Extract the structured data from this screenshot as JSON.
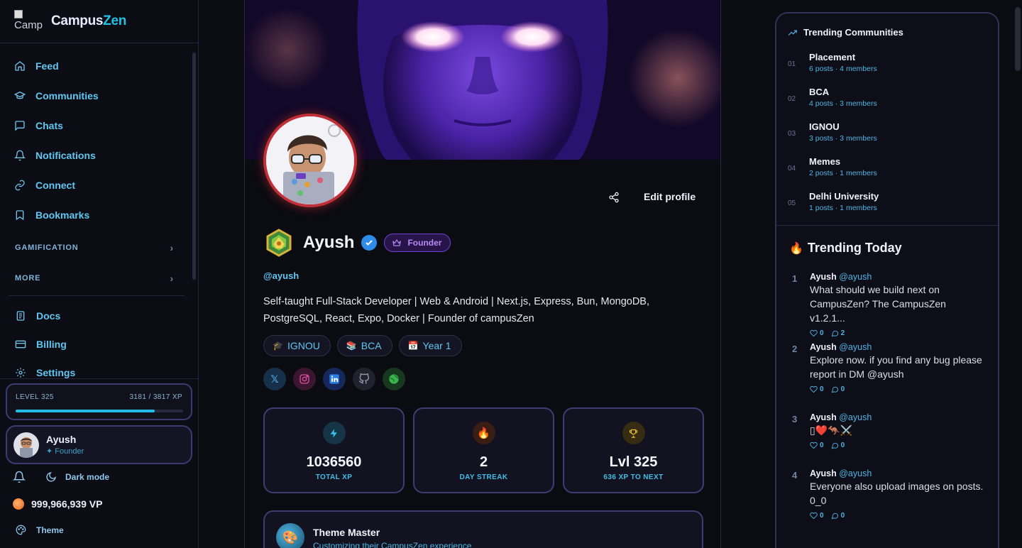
{
  "brand": {
    "logo_alt": "Camp",
    "name_part1": "Campus",
    "name_part2": "Zen"
  },
  "sidebar": {
    "nav": [
      {
        "label": "Feed",
        "icon": "home-icon"
      },
      {
        "label": "Communities",
        "icon": "graduation-cap-icon"
      },
      {
        "label": "Chats",
        "icon": "message-square-icon"
      },
      {
        "label": "Notifications",
        "icon": "bell-icon"
      },
      {
        "label": "Connect",
        "icon": "link-icon"
      },
      {
        "label": "Bookmarks",
        "icon": "bookmark-icon"
      }
    ],
    "section_gamification": "GAMIFICATION",
    "section_more": "MORE",
    "nav2": [
      {
        "label": "Docs",
        "icon": "document-icon"
      },
      {
        "label": "Billing",
        "icon": "credit-card-icon"
      },
      {
        "label": "Settings",
        "icon": "gear-icon"
      }
    ],
    "level": {
      "label": "LEVEL 325",
      "xp": "3181 / 3817 XP",
      "progress": 0.83
    },
    "user": {
      "name": "Ayush",
      "role": "✦ Founder"
    },
    "dark_mode_label": "Dark mode",
    "vp": "999,966,939 VP",
    "theme_label": "Theme"
  },
  "profile": {
    "edit_label": "Edit profile",
    "name": "Ayush",
    "founder_badge": "Founder",
    "handle": "@ayush",
    "bio": "Self-taught Full-Stack Developer | Web & Android | Next.js, Express, Bun, MongoDB, PostgreSQL, React, Expo, Docker | Founder of campusZen",
    "chips": [
      {
        "icon": "🎓",
        "label": "IGNOU"
      },
      {
        "icon": "📚",
        "label": "BCA"
      },
      {
        "icon": "📅",
        "label": "Year 1"
      }
    ],
    "stats": [
      {
        "value": "1036560",
        "label": "TOTAL XP"
      },
      {
        "value": "2",
        "label": "DAY STREAK"
      },
      {
        "value": "Lvl 325",
        "label": "636 XP TO NEXT"
      }
    ],
    "achievement": {
      "title": "Theme Master",
      "subtitle": "Customizing their CampusZen experience"
    }
  },
  "trending_communities": {
    "title": "Trending Communities",
    "items": [
      {
        "num": "01",
        "name": "Placement",
        "meta": "6 posts · 4 members"
      },
      {
        "num": "02",
        "name": "BCA",
        "meta": "4 posts · 3 members"
      },
      {
        "num": "03",
        "name": "IGNOU",
        "meta": "3 posts · 3 members"
      },
      {
        "num": "04",
        "name": "Memes",
        "meta": "2 posts · 1 members"
      },
      {
        "num": "05",
        "name": "Delhi University",
        "meta": "1 posts · 1 members"
      }
    ]
  },
  "trending_today": {
    "title": "Trending Today",
    "posts": [
      {
        "num": "1",
        "author": "Ayush",
        "handle": "@ayush",
        "text": "What should we build next on CampusZen? The CampusZen v1.2.1...",
        "likes": "0",
        "comments": "2"
      },
      {
        "num": "2",
        "author": "Ayush",
        "handle": "@ayush",
        "text": "Explore now. if you find any bug please report in DM @ayush",
        "likes": "0",
        "comments": "0"
      },
      {
        "num": "3",
        "author": "Ayush",
        "handle": "@ayush",
        "text": "▯❤️🦘⚔️",
        "likes": "0",
        "comments": "0"
      },
      {
        "num": "4",
        "author": "Ayush",
        "handle": "@ayush",
        "text": "Everyone also upload images on posts. 0_0",
        "likes": "0",
        "comments": "0"
      }
    ]
  },
  "colors": {
    "accent": "#22c2e6",
    "founder": "#b58af7",
    "level_fill": "#22bde6",
    "avatar_ring": "#c1303a"
  }
}
